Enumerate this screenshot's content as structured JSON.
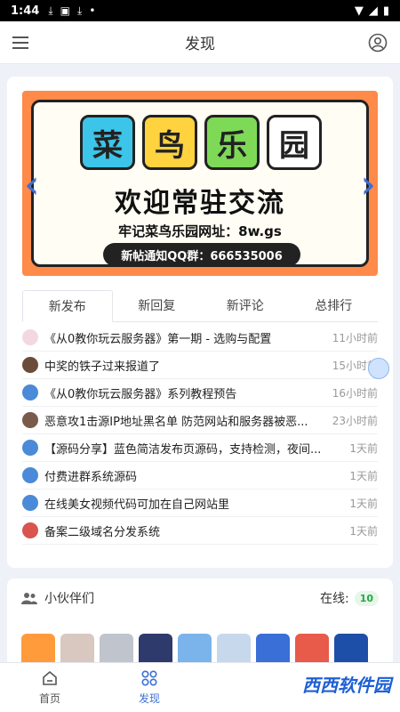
{
  "status": {
    "time": "1:44"
  },
  "header": {
    "title": "发现"
  },
  "banner": {
    "tiles": [
      "菜",
      "鸟",
      "乐",
      "园"
    ],
    "tile_colors": [
      "#3cc5e8",
      "#ffd23f",
      "#7ed957",
      "#ffffff"
    ],
    "welcome": "欢迎常驻交流",
    "address": "牢记菜鸟乐园网址：8w.gs",
    "qq": "新帖通知QQ群：666535006"
  },
  "tabs": [
    "新发布",
    "新回复",
    "新评论",
    "总排行"
  ],
  "posts": [
    {
      "title": "《从0教你玩云服务器》第一期 - 选购与配置",
      "time": "11小时前",
      "avatar_color": "#f3d9df"
    },
    {
      "title": "中奖的铁子过来报道了",
      "time": "15小时前",
      "avatar_color": "#6b4c3b"
    },
    {
      "title": "《从0教你玩云服务器》系列教程预告",
      "time": "16小时前",
      "avatar_color": "#4a8ad8"
    },
    {
      "title": "恶意攻1击源IP地址黑名单 防范网站和服务器被恶...",
      "time": "23小时前",
      "avatar_color": "#7a5a4a"
    },
    {
      "title": "【源码分享】蓝色简洁发布页源码，支持检测，夜间...",
      "time": "1天前",
      "avatar_color": "#4a8ad8"
    },
    {
      "title": "付费进群系统源码",
      "time": "1天前",
      "avatar_color": "#4a8ad8"
    },
    {
      "title": "在线美女视频代码可加在自己网站里",
      "time": "1天前",
      "avatar_color": "#4a8ad8"
    },
    {
      "title": "备案二级域名分发系统",
      "time": "1天前",
      "avatar_color": "#d9534f"
    }
  ],
  "partners": {
    "title": "小伙伴们",
    "online_label": "在线:",
    "online_count": "10",
    "avatar_colors": [
      "#ff9b3a",
      "#d8c8c0",
      "#c0c4cc",
      "#2d3a6b",
      "#7ab4ea",
      "#c8d8ec",
      "#3a6fd8",
      "#e85a4a",
      "#1e4fa8"
    ]
  },
  "nav": {
    "home": "首页",
    "discover": "发现"
  },
  "watermark": "西西软件园"
}
